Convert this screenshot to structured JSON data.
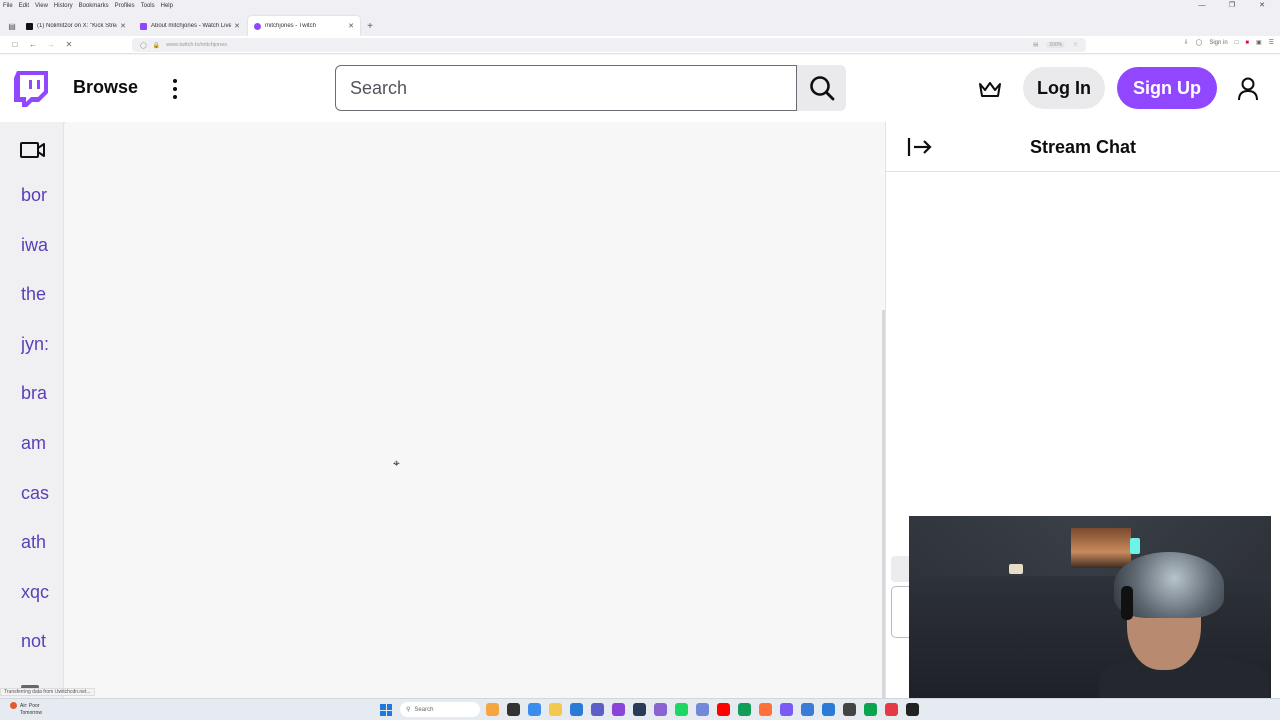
{
  "browser": {
    "menu": [
      "File",
      "Edit",
      "View",
      "History",
      "Bookmarks",
      "Profiles",
      "Tools",
      "Help"
    ],
    "tabs": [
      {
        "title": "(1) Nolimitzor on X: \"Kick Strea",
        "active": false,
        "favicon_color": "#111111"
      },
      {
        "title": "About mitchjones - Watch Live",
        "active": false,
        "favicon_color": "#9147ff"
      },
      {
        "title": "mitchjones - Twitch",
        "active": true,
        "favicon_color": "#9147ff"
      }
    ],
    "url": "www.twitch.tv/mitchjones",
    "zoom": "200%",
    "sign_in": "Sign in",
    "status_text": "Transferring data from i.twitchcdn.net..."
  },
  "twitch": {
    "brand_color": "#9147ff",
    "header": {
      "browse_label": "Browse",
      "search_placeholder": "Search",
      "login_label": "Log In",
      "signup_label": "Sign Up"
    },
    "sidebar": {
      "channels": [
        "bor",
        "iwa",
        "the",
        "jyn:",
        "bra",
        "am",
        "cas",
        "ath",
        "xqc",
        "not"
      ]
    },
    "chat": {
      "title": "Stream Chat"
    }
  },
  "taskbar": {
    "weather_line1": "Air: Poor",
    "weather_line2": "Tomorrow",
    "search_label": "Search",
    "app_icon_colors": [
      "#f4a640",
      "#333333",
      "#3c8cf0",
      "#f2c94c",
      "#2a7ad8",
      "#5b5fc7",
      "#8c44d8",
      "#2b3a55",
      "#8a63d2",
      "#1ed760",
      "#7289da",
      "#ff0000",
      "#0f9d58",
      "#ff7139",
      "#7a5af5",
      "#3a7bd5",
      "#2a7ad8",
      "#444444",
      "#0aa34f",
      "#e63946",
      "#222222"
    ]
  }
}
